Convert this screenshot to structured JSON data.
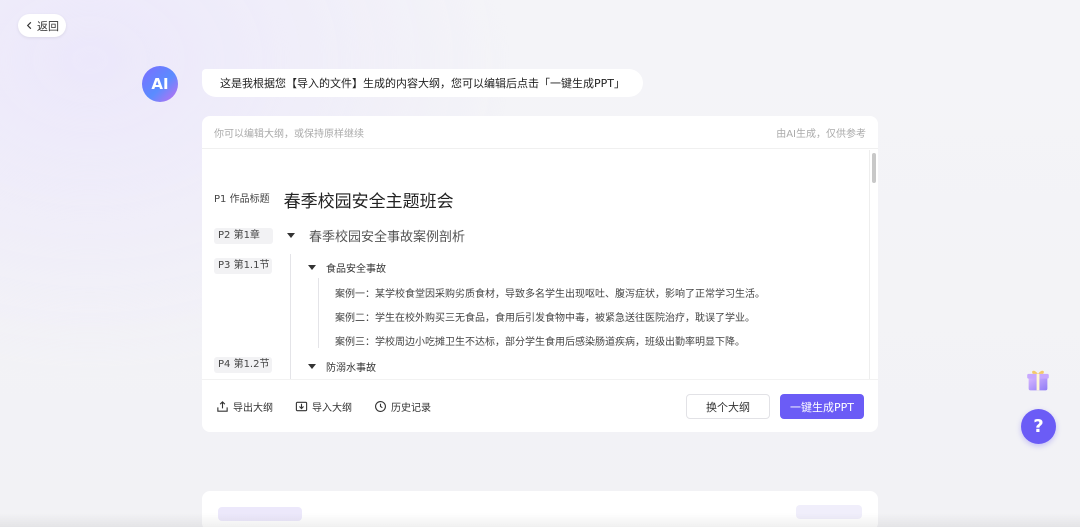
{
  "back": {
    "label": "返回"
  },
  "assistant": {
    "avatar_text": "AI",
    "message": "这是我根据您【导入的文件】生成的内容大纲，您可以编辑后点击「一键生成PPT」"
  },
  "outline_panel": {
    "hint_left": "你可以编辑大纲，或保持原样继续",
    "hint_right": "由AI生成，仅供参考",
    "title": {
      "tag": "P1 作品标题",
      "text": "春季校园安全主题班会"
    },
    "chapter": {
      "tag": "P2 第1章",
      "text": "春季校园安全事故案例剖析"
    },
    "sections": [
      {
        "tag": "P3 第1.1节",
        "text": "食品安全事故",
        "cases": [
          "案例一：某学校食堂因采购劣质食材，导致多名学生出现呕吐、腹泻症状，影响了正常学习生活。",
          "案例二：学生在校外购买三无食品，食用后引发食物中毒，被紧急送往医院治疗，耽误了学业。",
          "案例三：学校周边小吃摊卫生不达标，部分学生食用后感染肠道疾病，班级出勤率明显下降。"
        ]
      },
      {
        "tag": "P4 第1.2节",
        "text": "防溺水事故",
        "cases": []
      }
    ],
    "footer": {
      "export_label": "导出大纲",
      "import_label": "导入大纲",
      "history_label": "历史记录",
      "switch_label": "换个大纲",
      "generate_label": "一键生成PPT"
    }
  },
  "help": {
    "label": "?"
  },
  "colors": {
    "accent": "#6b5cf6",
    "background": "#f3f3f6",
    "panel": "#ffffff"
  },
  "icons": [
    "chevron-left-icon",
    "export-icon",
    "import-icon",
    "history-icon",
    "gift-icon",
    "caret-down-icon"
  ]
}
